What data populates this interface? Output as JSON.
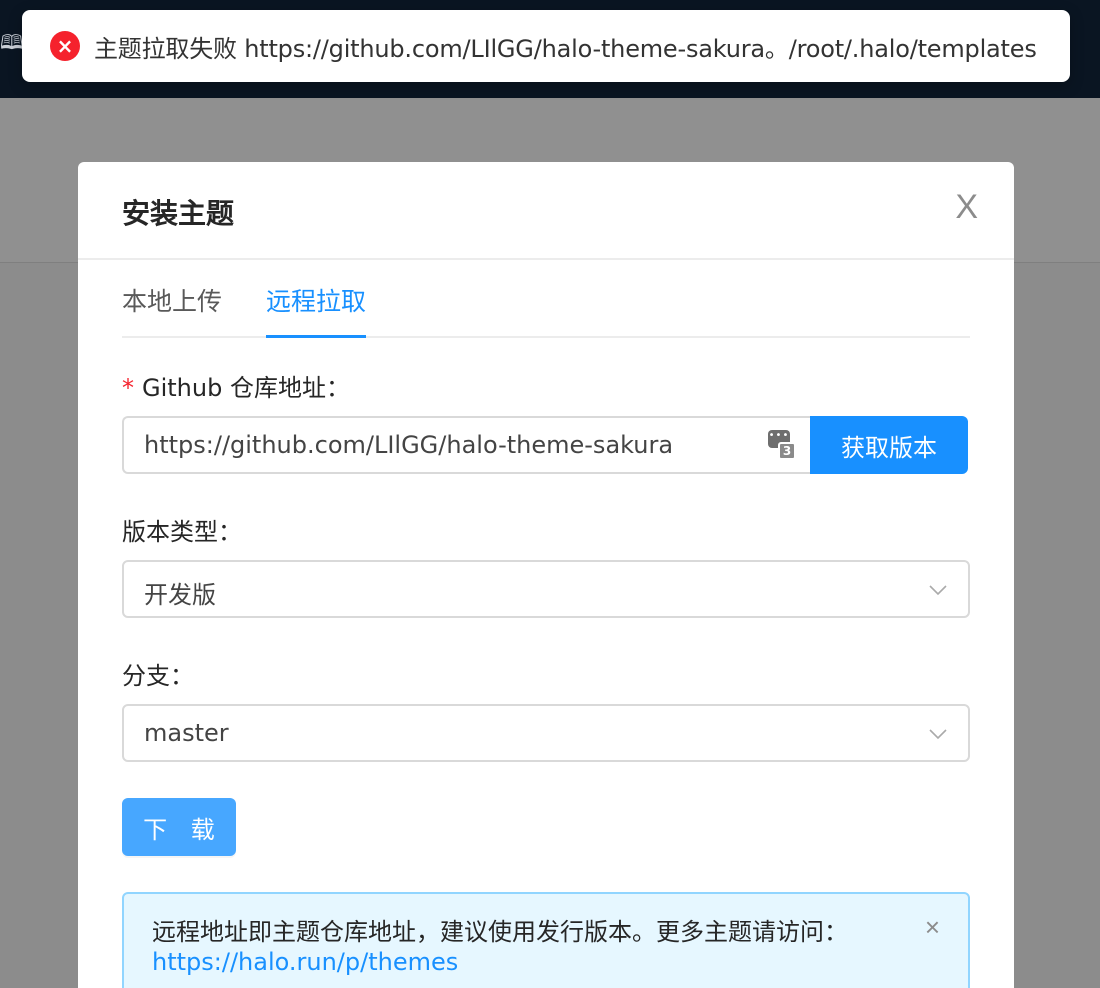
{
  "toast": {
    "message": "主题拉取失败 https://github.com/LIlGG/halo-theme-sakura。/root/.halo/templates",
    "icon": "error-circle-icon",
    "color": "#f5222d"
  },
  "modal": {
    "title": "安装主题",
    "close": "X",
    "tabs": [
      "本地上传",
      "远程拉取"
    ],
    "active_tab": 1,
    "repo": {
      "label": "Github 仓库地址：",
      "required_mark": "*",
      "value": "https://github.com/LIlGG/halo-theme-sakura",
      "ext_badge_count": "3",
      "fetch_label": "获取版本"
    },
    "version_type": {
      "label": "版本类型：",
      "value": "开发版"
    },
    "branch": {
      "label": "分支：",
      "value": "master"
    },
    "download_label": "下 载",
    "alert": {
      "text": "远程地址即主题仓库地址，建议使用发行版本。更多主题请访问：",
      "link": "https://halo.run/p/themes",
      "close": "×"
    }
  },
  "colors": {
    "primary": "#1890ff",
    "error": "#f5222d",
    "info_bg": "#e6f7ff"
  }
}
